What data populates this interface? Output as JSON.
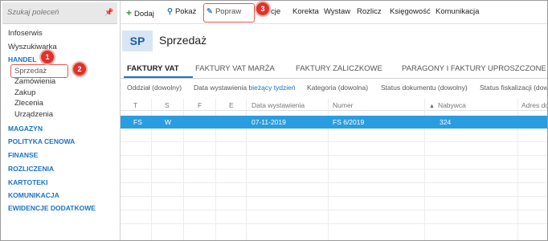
{
  "sidebar": {
    "search_placeholder": "Szukaj poleceń",
    "top_items": [
      "Infoserwis",
      "Wyszukiwarka"
    ],
    "handel": {
      "label": "HANDEL",
      "sub_items": [
        "Sprzedaż",
        "Zamówienia",
        "Zakup",
        "Zlecenia",
        "Urządzenia"
      ]
    },
    "sections": [
      "MAGAZYN",
      "POLITYKA CENOWA",
      "FINANSE",
      "ROZLICZENIA",
      "KARTOTEKI",
      "KOMUNIKACJA",
      "EWIDENCJE DODATKOWE"
    ]
  },
  "toolbar": {
    "dodaj": "Dodaj",
    "pokaz": "Pokaż",
    "popraw": "Popraw",
    "akcje": "cje",
    "korekta": "Korekta",
    "wystaw": "Wystaw",
    "rozlicz": "Rozlicz",
    "ksiegowosc": "Księgowość",
    "komunikacja": "Komunikacja"
  },
  "header": {
    "badge": "SP",
    "title": "Sprzedaż"
  },
  "tabs": [
    "FAKTURY VAT",
    "FAKTURY VAT MARŻA",
    "FAKTURY ZALICZKOWE",
    "PARAGONY I FAKTURY UPROSZCZONE"
  ],
  "filters": {
    "oddzial": "Oddział (dowolny)",
    "data_label": "Data wystawienia",
    "data_value": "bieżący tydzień",
    "kategoria": "Kategoria (dowolna)",
    "status": "Status dokumentu (dowolny)",
    "fiskalizacja": "Status fiskalizacji (dowoln"
  },
  "grid": {
    "columns": [
      "T",
      "S",
      "F",
      "E",
      "Data wystawienia",
      "Numer",
      "Nabywca",
      "Adres do"
    ],
    "rows": [
      {
        "t": "FS",
        "s": "W",
        "f": "",
        "e": "",
        "data": "07-11-2019",
        "numer": "FS 6/2019",
        "nabywca": "324"
      }
    ]
  },
  "callouts": [
    "1",
    "2",
    "3"
  ],
  "colors": {
    "accent": "#1a73c8",
    "selected_row": "#2a9de0",
    "callout": "#e0312a"
  }
}
